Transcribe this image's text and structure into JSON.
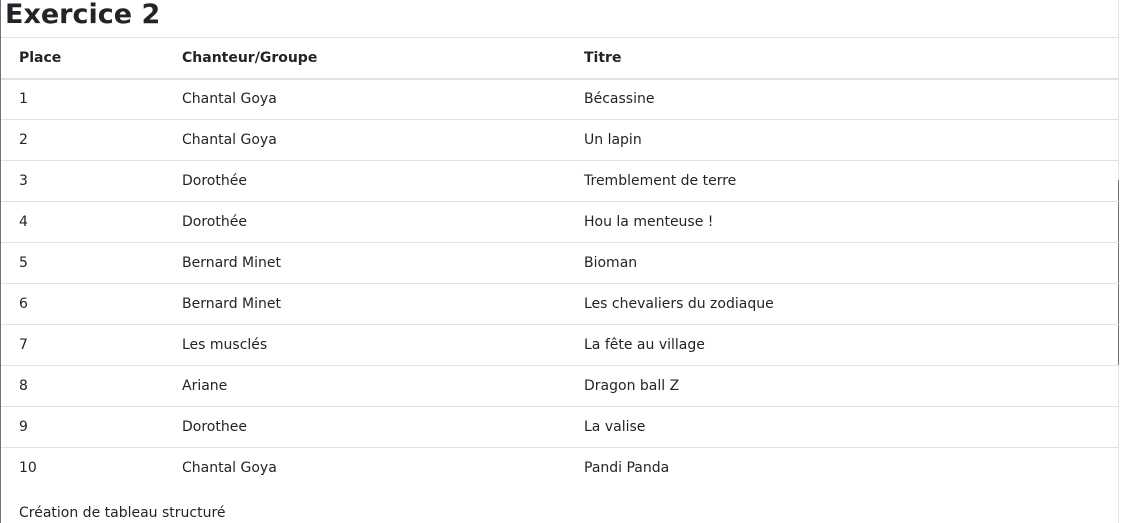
{
  "page": {
    "title": "Exercice 2",
    "caption": "Création de tableau structuré"
  },
  "table": {
    "headers": {
      "place": "Place",
      "artist": "Chanteur/Groupe",
      "title": "Titre"
    },
    "rows": [
      {
        "place": "1",
        "artist": "Chantal Goya",
        "title": "Bécassine"
      },
      {
        "place": "2",
        "artist": "Chantal Goya",
        "title": "Un lapin"
      },
      {
        "place": "3",
        "artist": "Dorothée",
        "title": "Tremblement de terre"
      },
      {
        "place": "4",
        "artist": "Dorothée",
        "title": "Hou la menteuse !"
      },
      {
        "place": "5",
        "artist": "Bernard Minet",
        "title": "Bioman"
      },
      {
        "place": "6",
        "artist": "Bernard Minet",
        "title": "Les chevaliers du zodiaque"
      },
      {
        "place": "7",
        "artist": "Les musclés",
        "title": "La fête au village"
      },
      {
        "place": "8",
        "artist": "Ariane",
        "title": "Dragon ball Z"
      },
      {
        "place": "9",
        "artist": "Dorothee",
        "title": "La valise"
      },
      {
        "place": "10",
        "artist": "Chantal Goya",
        "title": "Pandi Panda"
      }
    ]
  },
  "colors": {
    "text": "#212529",
    "border": "#dee2e6",
    "background": "#ffffff"
  }
}
